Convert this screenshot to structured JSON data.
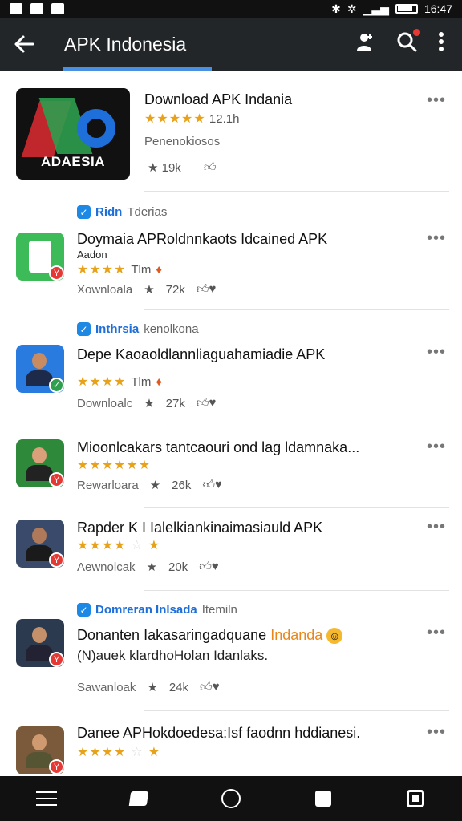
{
  "status_bar": {
    "time": "16:47"
  },
  "app_bar": {
    "title": "APK Indonesia"
  },
  "featured": {
    "title": "Download APK Indania",
    "rating_stars": "★★★★★",
    "rating_count": "12.1h",
    "subtitle": "Penenokiosos",
    "logo_text": "ADAESIA",
    "stat_stars": "19k",
    "stat_likes": ""
  },
  "items": [
    {
      "verified_name": "Ridn",
      "verified_sub": "Tderias",
      "title": "Doymaia APRoldnnkaots Idcained APK",
      "subtitle": "Aadon",
      "stars": "★★★★",
      "rating_text": "Tlm",
      "stats_label": "Xownloala",
      "stat_a": "72k",
      "badge": "Y",
      "icon_color": "#3dbb58"
    },
    {
      "verified_name": "Inthrsia",
      "verified_sub": "kenolkona",
      "title": "Depe Kaoaoldlannliaguahamiadie APK",
      "stars": "★★★★",
      "rating_text": "Tlm",
      "stats_label": "Downloalc",
      "stat_a": "27k",
      "badge": "✓",
      "icon_color": "#2a7be0"
    },
    {
      "title": "Mioonlcakars tantcaouri ond lag ldamnaka...",
      "stars": "★★★★★★",
      "stats_label": "Rewarloara",
      "stat_a": "26k",
      "badge": "Y",
      "icon_color": "#2e8a3a"
    },
    {
      "title": "Rapder K I Ialelkiankinaimasiauld APK",
      "stars": "★★★★",
      "stars_empty": "☆",
      "star_last": "★",
      "stats_label": "Aewnolcak",
      "stat_a": "20k",
      "badge": "Y",
      "icon_color": "#3a4a6a"
    },
    {
      "verified_name": "Domreran Inlsada",
      "verified_sub": "Itemiln",
      "title": "Donanten Iakasaringadquane",
      "title_highlight": "Indanda",
      "subtitle": "(N)auek klardhoHolan Idanlaks.",
      "stats_label": "Sawanloak",
      "stat_a": "24k",
      "badge": "Y",
      "icon_color": "#2b3a4e"
    },
    {
      "title": "Danee APHokdoedesa:Isf faodnn hddianesi.",
      "stars": "★★★★",
      "stars_empty": "☆",
      "star_last": "★",
      "badge": "Y",
      "icon_color": "#7a5a3a"
    }
  ]
}
